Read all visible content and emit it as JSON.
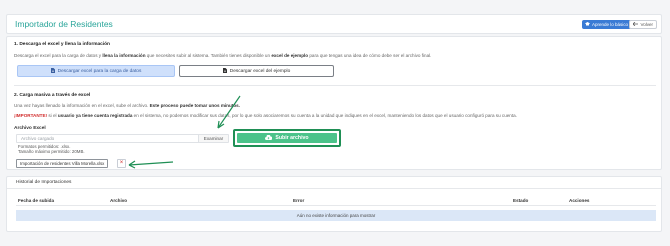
{
  "header": {
    "title": "Importador de Residentes",
    "help_label": "Aprende lo básico",
    "help_icon": "graduation-cap-icon",
    "back_label": "Volver",
    "back_icon": "arrow-left-icon"
  },
  "step1": {
    "title": "1. Descarga el excel y llena la información",
    "desc_1": "Descarga el excel para la carga de datos y ",
    "desc_bold_1": "llena la información",
    "desc_2": " que necesites subir al sistema. También tienes disponible un ",
    "desc_bold_2": "excel de ejemplo",
    "desc_3": " para que tengas una idea de cómo debe ser el archivo final.",
    "download_label": "Descargar excel para la carga de datos",
    "example_label": "Descargar excel del ejemplo",
    "download_icon": "file-download-icon"
  },
  "step2": {
    "title": "2. Carga masiva a través de excel",
    "desc_1": "Una vez hayas llenado la información en el excel, sube el archivo. ",
    "desc_bold": "Este proceso puede tomar unos minutos.",
    "important_label": "¡IMPORTANTE!",
    "important_1": " si el ",
    "important_bold": "usuario ya tiene cuenta registrada",
    "important_2": " en el sistema, no podemos modificar sus datos, por lo que solo asociaremos su cuenta a la unidad que indiques en el excel, manteniendo los datos que el usuario configuró para su cuenta.",
    "file_label": "Archivo Excel",
    "file_placeholder": "Archivo cargado",
    "browse_label": "Examinar",
    "formats": "Formatos permitidos: .xlsx.",
    "max_size": "Tamaño máximo permitido: 20MB.",
    "upload_label": "Subir archivo",
    "upload_icon": "cloud-upload-icon",
    "selected_file": "Importación de residentes Villa Morella.xlsx",
    "remove_icon": "close-icon"
  },
  "history": {
    "title": "Historial de Importaciones",
    "columns": [
      "Fecha de subida",
      "Archivo",
      "Error",
      "Estado",
      "Acciones"
    ],
    "empty_message": "Aún no existe información para mostrar"
  },
  "colors": {
    "title_teal": "#2aa59a",
    "upload_green": "#4bc38a",
    "arrow_green": "#1f8f55",
    "important_red": "#d12b2b",
    "help_blue": "#3a7bd5"
  }
}
